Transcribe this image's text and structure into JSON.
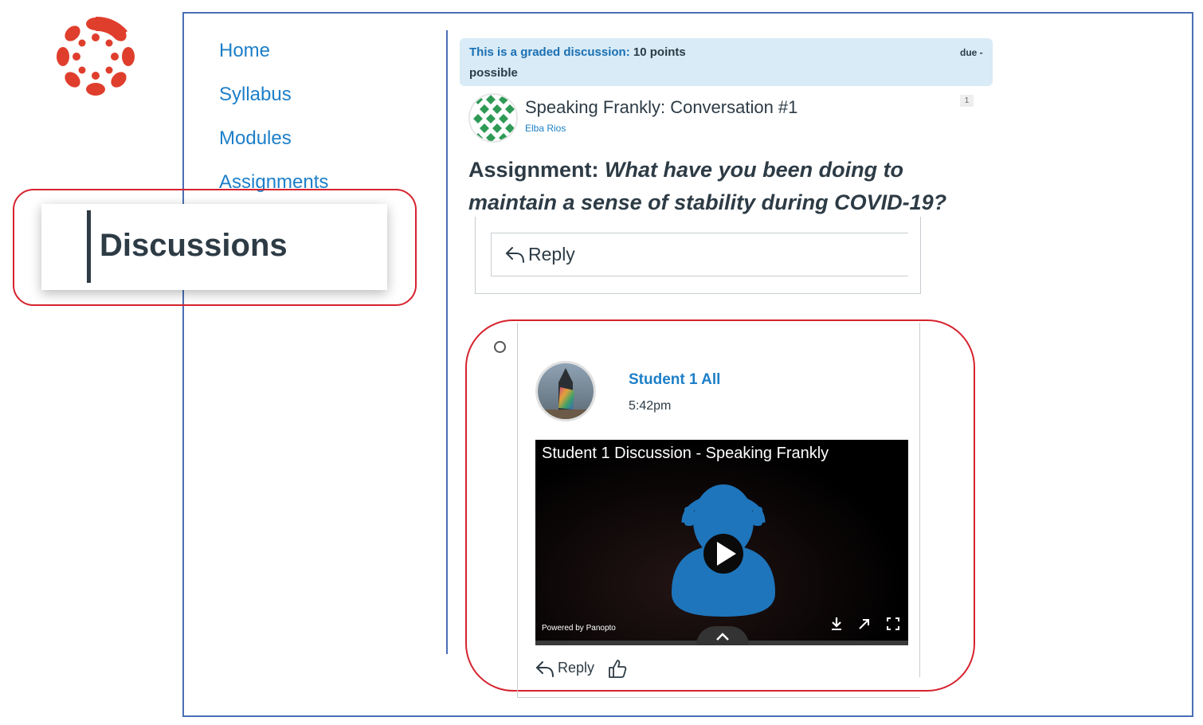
{
  "nav": {
    "items": [
      {
        "label": "Home"
      },
      {
        "label": "Syllabus"
      },
      {
        "label": "Modules"
      },
      {
        "label": "Assignments"
      }
    ],
    "highlighted": "Discussions"
  },
  "banner": {
    "graded_label": "This is a graded discussion:",
    "points": "10 points",
    "possible": "possible",
    "due": "due -"
  },
  "topic": {
    "title": "Speaking Frankly: Conversation #1",
    "author": "Elba Rios",
    "count": "1",
    "assignment_prefix": "Assignment:",
    "assignment_question": "What have you been doing to maintain a sense of stability during COVID-19?",
    "reply_label": "Reply"
  },
  "entry": {
    "author": "Student 1 All",
    "time": "5:42pm",
    "video": {
      "title": "Student 1 Discussion - Speaking Frankly",
      "powered_by": "Powered by Panopto"
    },
    "reply_label": "Reply"
  },
  "colors": {
    "link_blue": "#1d7fc9",
    "highlight_red": "#d6232e",
    "frame_blue": "#4a6fb5",
    "banner_bg": "#d8ebf6",
    "logo_red": "#e03e2d",
    "panopto_figure": "#1e75bb"
  }
}
